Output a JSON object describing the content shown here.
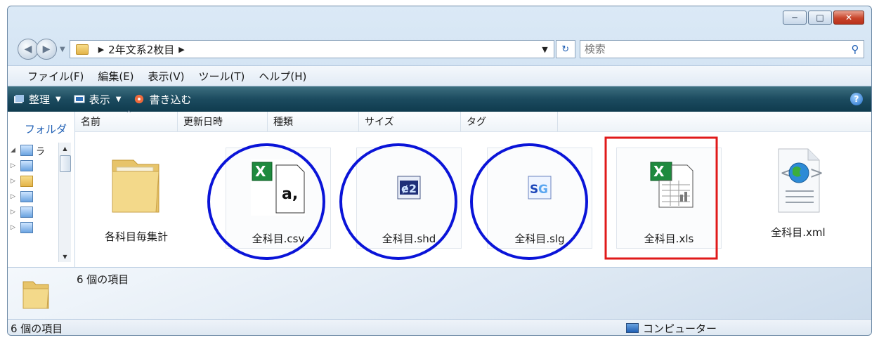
{
  "window": {
    "minimize_glyph": "─",
    "maximize_glyph": "□",
    "close_glyph": "✕"
  },
  "address": {
    "path": [
      "2年文系2枚目"
    ],
    "search_placeholder": "検索"
  },
  "menu": [
    "ファイル(F)",
    "編集(E)",
    "表示(V)",
    "ツール(T)",
    "ヘルプ(H)"
  ],
  "toolbar": {
    "organize": "整理",
    "view": "表示",
    "burn": "書き込む",
    "help": "?"
  },
  "navpane": {
    "title": "フォルダ",
    "tree_first_label": "ラ"
  },
  "columns": [
    "名前",
    "更新日時",
    "種類",
    "サイズ",
    "タグ"
  ],
  "files": [
    {
      "name": "各科目毎集計",
      "icon": "folder-icon"
    },
    {
      "name": "全科目.csv",
      "icon": "excel-csv-icon",
      "annotation": "blue-circle"
    },
    {
      "name": "全科目.shd",
      "icon": "shd-file-icon",
      "annotation": "blue-circle"
    },
    {
      "name": "全科目.slg",
      "icon": "slg-file-icon",
      "annotation": "blue-circle"
    },
    {
      "name": "全科目.xls",
      "icon": "excel-xls-icon",
      "annotation": "red-box"
    },
    {
      "name": "全科目.xml",
      "icon": "xml-file-icon"
    }
  ],
  "details": {
    "summary": "6 個の項目"
  },
  "status": {
    "left": "6 個の項目",
    "right": "コンピューター"
  },
  "colors": {
    "annotation_blue": "#0a14d8",
    "annotation_red": "#e01a1a",
    "toolbar": "#1c4b5f"
  }
}
